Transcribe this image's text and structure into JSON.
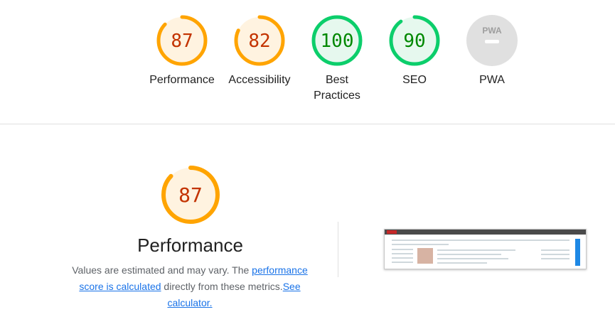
{
  "colors": {
    "average": "#ffa400",
    "average_fill": "#fff3e0",
    "average_text": "#c33300",
    "pass": "#0cce6b",
    "pass_fill": "#e6f8ee",
    "pass_text": "#008800",
    "na": "#e0e0e0",
    "link": "#1a73e8"
  },
  "categories": [
    {
      "label": "Performance",
      "score": "87",
      "fraction": 0.87,
      "status": "average"
    },
    {
      "label": "Accessibility",
      "score": "82",
      "fraction": 0.82,
      "status": "average"
    },
    {
      "label": "Best Practices",
      "score": "100",
      "fraction": 1.0,
      "status": "pass"
    },
    {
      "label": "SEO",
      "score": "90",
      "fraction": 0.9,
      "status": "pass"
    },
    {
      "label": "PWA",
      "score": "",
      "fraction": 0,
      "status": "na",
      "badge": "PWA"
    }
  ],
  "performance": {
    "score": "87",
    "fraction": 0.87,
    "title": "Performance",
    "desc_prefix": "Values are estimated and may vary. The ",
    "link1": "performance score is calculated",
    "desc_middle": " directly from these metrics.",
    "link2": "See calculator."
  },
  "screenshot": {
    "icon": "page-screenshot-thumbnail"
  }
}
